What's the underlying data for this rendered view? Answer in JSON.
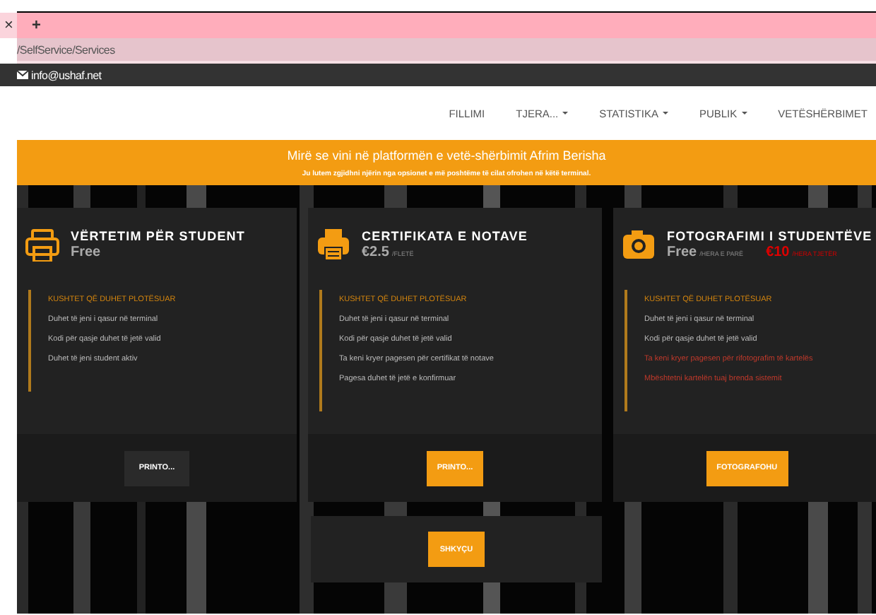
{
  "browser": {
    "tabs": [
      {
        "label": "×",
        "kind": "close"
      },
      {
        "label": "+",
        "kind": "new"
      }
    ],
    "address": "/SelfService/Services"
  },
  "topbar": {
    "email": "info@ushaf.net"
  },
  "nav": {
    "items": [
      {
        "label": "FILLIMI",
        "dropdown": false
      },
      {
        "label": "TJERA...",
        "dropdown": true
      },
      {
        "label": "STATISTIKA",
        "dropdown": true
      },
      {
        "label": "PUBLIK",
        "dropdown": true
      },
      {
        "label": "VETËSHËRBIMET",
        "dropdown": false
      }
    ]
  },
  "banner": {
    "title": "Mirë se vini në platformën e vetë-shërbimit Afrim Berisha",
    "subtitle": "Ju lutem zgjidhni njërin nga opsionet e më poshtëme të cilat ofrohen në këtë terminal."
  },
  "cards": [
    {
      "title": "VËRTETIM PËR STUDENT",
      "price": "Free",
      "conditions_title": "KUSHTET QË DUHET PLOTËSUAR",
      "conditions": [
        {
          "text": "Duhet të jeni i qasur në terminal",
          "kind": "ok"
        },
        {
          "text": "Kodi për qasje duhet të jetë valid",
          "kind": "ok"
        },
        {
          "text": "Duhet të jeni student aktiv",
          "kind": "ok"
        }
      ],
      "buttons": [
        {
          "label": "PRINTO...",
          "kind": "dark"
        }
      ]
    },
    {
      "title": "CERTIFIKATA E NOTAVE",
      "price": "€2.5",
      "unit": "/FLETË",
      "conditions_title": "KUSHTET QË DUHET PLOTËSUAR",
      "conditions": [
        {
          "text": "Duhet të jeni i qasur në terminal",
          "kind": "ok"
        },
        {
          "text": "Kodi për qasje duhet të jetë valid",
          "kind": "ok"
        },
        {
          "text": "Ta keni kryer pagesen për certifikat të notave",
          "kind": "ok"
        },
        {
          "text": "Pagesa duhet të jetë e konfirmuar",
          "kind": "ok"
        }
      ],
      "buttons": [
        {
          "label": "PRINTO...",
          "kind": "primary"
        },
        {
          "label": "SHKYÇU",
          "kind": "primary"
        }
      ]
    },
    {
      "title": "FOTOGRAFIMI I STUDENTËVE",
      "price": "Free",
      "unit": "/HERA E PARË",
      "extra_price": "€10",
      "extra_unit": "/HERA TJETËR",
      "conditions_title": "KUSHTET QË DUHET PLOTËSUAR",
      "conditions": [
        {
          "text": "Duhet të jeni i qasur në terminal",
          "kind": "ok"
        },
        {
          "text": "Kodi për qasje duhet të jetë valid",
          "kind": "ok"
        },
        {
          "text": "Ta keni kryer pagesen për rifotografim të kartelës",
          "kind": "unmet"
        },
        {
          "text": "Mbështetni kartelën tuaj brenda sistemit",
          "kind": "unmet"
        }
      ],
      "buttons": [
        {
          "label": "FOTOGRAFOHU",
          "kind": "primary"
        }
      ]
    }
  ]
}
